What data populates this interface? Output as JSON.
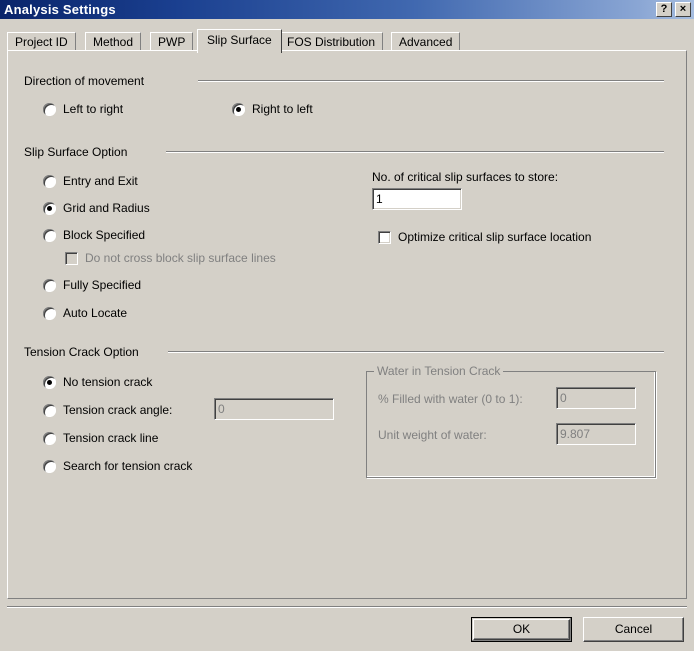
{
  "window": {
    "title": "Analysis Settings",
    "help_button": "?",
    "close_button": "×"
  },
  "tabs": [
    {
      "label": "Project ID",
      "active": false
    },
    {
      "label": "Method",
      "active": false
    },
    {
      "label": "PWP",
      "active": false
    },
    {
      "label": "Slip Surface",
      "active": true
    },
    {
      "label": "FOS Distribution",
      "active": false
    },
    {
      "label": "Advanced",
      "active": false
    }
  ],
  "direction_of_movement": {
    "heading": "Direction of movement",
    "options": [
      {
        "label": "Left to right",
        "selected": false
      },
      {
        "label": "Right to left",
        "selected": true
      }
    ]
  },
  "slip_surface_option": {
    "heading": "Slip Surface Option",
    "options": [
      {
        "label": "Entry and Exit",
        "selected": false
      },
      {
        "label": "Grid and Radius",
        "selected": true
      },
      {
        "label": "Block Specified",
        "selected": false
      },
      {
        "label": "Fully Specified",
        "selected": false
      },
      {
        "label": "Auto Locate",
        "selected": false
      }
    ],
    "block_checkbox": {
      "label": "Do not cross block slip surface lines",
      "checked": false,
      "disabled": true
    },
    "store_count": {
      "label": "No. of critical slip surfaces to store:",
      "value": "1"
    },
    "optimize_checkbox": {
      "label": "Optimize critical slip surface location",
      "checked": false,
      "disabled": false
    }
  },
  "tension_crack_option": {
    "heading": "Tension Crack Option",
    "options": [
      {
        "label": "No tension crack",
        "selected": true
      },
      {
        "label": "Tension crack angle:",
        "selected": false
      },
      {
        "label": "Tension crack line",
        "selected": false
      },
      {
        "label": "Search for tension crack",
        "selected": false
      }
    ],
    "angle_value": "0",
    "angle_disabled": true,
    "water_group": {
      "title": "Water in Tension Crack",
      "disabled": true,
      "fields": [
        {
          "label": "% Filled with water (0 to 1):",
          "value": "0"
        },
        {
          "label": "Unit weight of water:",
          "value": "9.807"
        }
      ]
    }
  },
  "footer": {
    "ok_label": "OK",
    "cancel_label": "Cancel"
  },
  "colors": {
    "dialog_face": "#d4d0c8",
    "titlebar_start": "#0a246a",
    "titlebar_end": "#a6bddf",
    "disabled_text": "#808080",
    "field_background": "#ffffff"
  }
}
